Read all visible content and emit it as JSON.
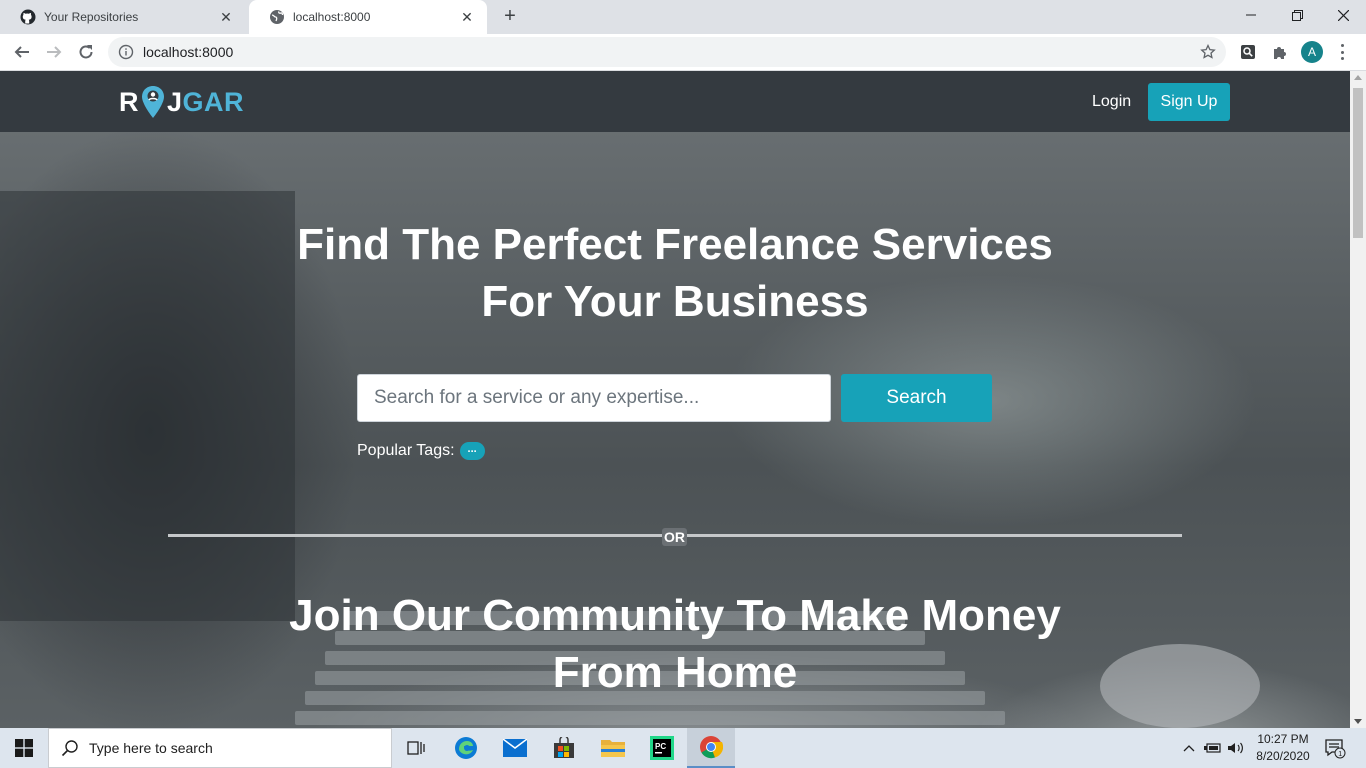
{
  "browser": {
    "tabs": [
      {
        "title": "Your Repositories",
        "icon": "github-icon",
        "active": false
      },
      {
        "title": "localhost:8000",
        "icon": "globe-icon",
        "active": true
      }
    ],
    "url": "localhost:8000",
    "avatar_letter": "A"
  },
  "site": {
    "logo": {
      "part1": "R",
      "part2": "J",
      "part3": "GAR"
    },
    "nav": {
      "login": "Login",
      "signup": "Sign Up"
    },
    "hero": {
      "line1": "Find The Perfect Freelance Services",
      "line2": "For Your Business",
      "search_placeholder": "Search for a service or any expertise...",
      "search_button": "Search",
      "popular_label": "Popular Tags:",
      "popular_tag": "..."
    },
    "divider_text": "OR",
    "join": {
      "line1": "Join Our Community To Make Money",
      "line2": "From Home"
    }
  },
  "taskbar": {
    "search_placeholder": "Type here to search",
    "time": "10:27 PM",
    "date": "8/20/2020",
    "notification_count": "1"
  },
  "colors": {
    "accent": "#17a2b8",
    "navbar": "#343a40",
    "logo_blue": "#4fb4d8"
  }
}
